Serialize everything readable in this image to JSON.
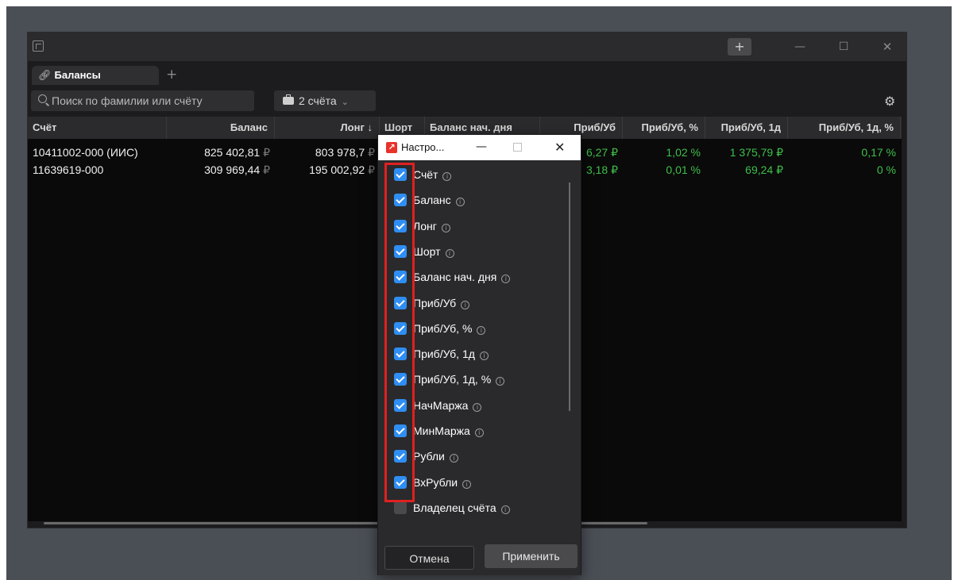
{
  "window": {
    "new_window_label": "+",
    "minimize_label": "—",
    "maximize_label": "☐",
    "close_label": "✕"
  },
  "tabs": [
    {
      "label": "Балансы",
      "icon": "link-icon"
    }
  ],
  "tab_add_label": "+",
  "toolbar": {
    "search_placeholder": "Поиск по фамилии или счёту",
    "accounts_label": "2 счёта",
    "settings_icon": "gear-icon"
  },
  "table": {
    "columns": [
      "Счёт",
      "Баланс",
      "Лонг ↓",
      "Шорт",
      "Баланс нач. дня",
      "Приб/Уб",
      "Приб/Уб, %",
      "Приб/Уб, 1д",
      "Приб/Уб, 1д, %"
    ],
    "rows": [
      {
        "account": "10411002-000 (ИИС)",
        "balance": "825 402,81",
        "long": "803 978,7",
        "pnl_partial": "6,27 ₽",
        "pnl_pct": "1,02 %",
        "pnl_1d": "1 375,79 ₽",
        "pnl_1d_pct": "0,17 %"
      },
      {
        "account": "11639619-000",
        "balance": "309 969,44",
        "long": "195 002,92",
        "pnl_partial": "3,18 ₽",
        "pnl_pct": "0,01 %",
        "pnl_1d": "69,24 ₽",
        "pnl_1d_pct": "0 %"
      }
    ],
    "currency_symbol": "₽"
  },
  "dialog": {
    "title": "Настро...",
    "minimize_label": "—",
    "close_label": "✕",
    "options": [
      {
        "label": "Счёт",
        "checked": true
      },
      {
        "label": "Баланс",
        "checked": true
      },
      {
        "label": "Лонг",
        "checked": true
      },
      {
        "label": "Шорт",
        "checked": true
      },
      {
        "label": "Баланс нач. дня",
        "checked": true
      },
      {
        "label": "Приб/Уб",
        "checked": true
      },
      {
        "label": "Приб/Уб, %",
        "checked": true
      },
      {
        "label": "Приб/Уб, 1д",
        "checked": true
      },
      {
        "label": "Приб/Уб, 1д, %",
        "checked": true
      },
      {
        "label": "НачМаржа",
        "checked": true
      },
      {
        "label": "МинМаржа",
        "checked": true
      },
      {
        "label": "Рубли",
        "checked": true
      },
      {
        "label": "ВхРубли",
        "checked": true
      },
      {
        "label": "Владелец счёта",
        "checked": false
      }
    ],
    "info_glyph": "i",
    "cancel_label": "Отмена",
    "apply_label": "Применить"
  },
  "colors": {
    "accent_checkbox": "#2f8ef3",
    "profit_green": "#3fbf4a",
    "highlight_red": "#e02020",
    "brand_red": "#e8322a"
  }
}
